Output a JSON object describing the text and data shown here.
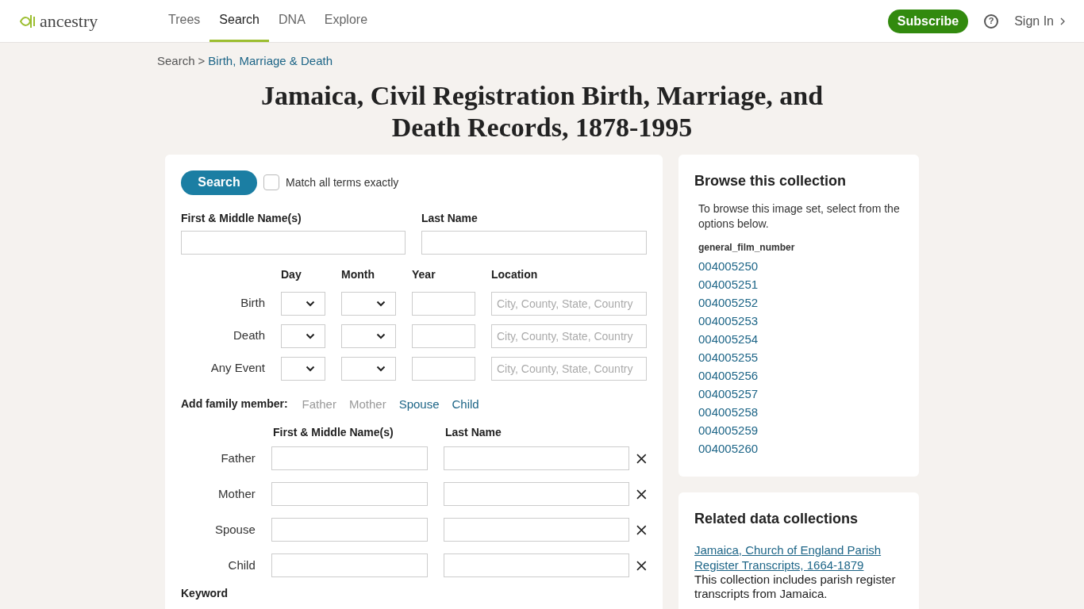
{
  "header": {
    "logo": "ancestry",
    "nav": [
      {
        "label": "Trees",
        "selected": false
      },
      {
        "label": "Search",
        "selected": true
      },
      {
        "label": "DNA",
        "selected": false
      },
      {
        "label": "Explore",
        "selected": false
      }
    ],
    "subscribe": "Subscribe",
    "help": "?",
    "sign_in": "Sign In"
  },
  "breadcrumb": {
    "root": "Search",
    "separator": ">",
    "current": "Birth, Marriage & Death"
  },
  "title": "Jamaica, Civil Registration Birth, Marriage, and Death Records, 1878-1995",
  "form": {
    "search_button": "Search",
    "match_exactly": {
      "label": "Match all terms exactly",
      "checked": false
    },
    "first_name_label": "First & Middle Name(s)",
    "last_name_label": "Last Name",
    "event_columns": [
      "Day",
      "Month",
      "Year",
      "Location"
    ],
    "events": [
      {
        "label": "Birth",
        "location_placeholder": "City, County, State, Country"
      },
      {
        "label": "Death",
        "location_placeholder": "City, County, State, Country"
      },
      {
        "label": "Any Event",
        "location_placeholder": "City, County, State, Country"
      }
    ],
    "add_family_label": "Add family member:",
    "family_links": [
      {
        "label": "Father",
        "disabled": true
      },
      {
        "label": "Mother",
        "disabled": true
      },
      {
        "label": "Spouse",
        "disabled": false
      },
      {
        "label": "Child",
        "disabled": false
      }
    ],
    "family_columns": [
      "First & Middle Name(s)",
      "Last Name"
    ],
    "family_rows": [
      "Father",
      "Mother",
      "Spouse",
      "Child"
    ],
    "keyword_label": "Keyword"
  },
  "browse": {
    "title": "Browse this collection",
    "description": "To browse this image set, select from the options below.",
    "field_label": "general_film_number",
    "items": [
      "004005250",
      "004005251",
      "004005252",
      "004005253",
      "004005254",
      "004005255",
      "004005256",
      "004005257",
      "004005258",
      "004005259",
      "004005260"
    ]
  },
  "related": {
    "title": "Related data collections",
    "link": "Jamaica, Church of England Parish Register Transcripts, 1664-1879",
    "description": "This collection includes parish register transcripts from Jamaica."
  }
}
